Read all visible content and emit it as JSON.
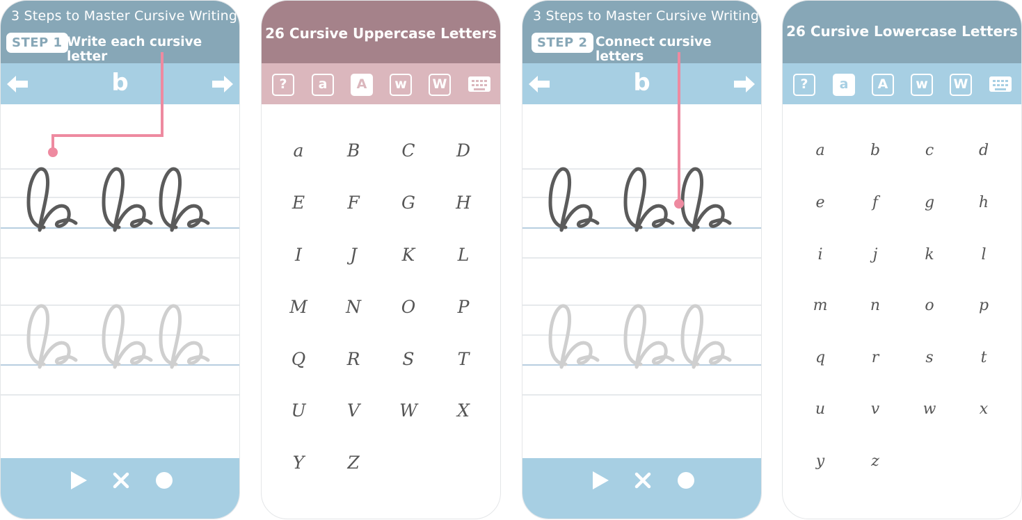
{
  "screens": {
    "step1": {
      "title": "3 Steps to Master Cursive Writing",
      "badge": "STEP 1",
      "caption": "Write each cursive letter",
      "letter": "b"
    },
    "uppercase": {
      "title": "26 Cursive Uppercase Letters",
      "tools": [
        "?",
        "a",
        "A",
        "w",
        "W"
      ],
      "active_tool": "A",
      "letters": [
        "a",
        "B",
        "C",
        "D",
        "E",
        "F",
        "G",
        "H",
        "I",
        "J",
        "K",
        "L",
        "M",
        "N",
        "O",
        "P",
        "Q",
        "R",
        "S",
        "T",
        "U",
        "V",
        "W",
        "X",
        "Y",
        "Z"
      ]
    },
    "step2": {
      "title": "3 Steps to Master Cursive Writing",
      "badge": "STEP 2",
      "caption": "Connect cursive letters",
      "letter": "b"
    },
    "lowercase": {
      "title": "26 Cursive Lowercase Letters",
      "tools": [
        "?",
        "a",
        "A",
        "w",
        "W"
      ],
      "active_tool": "a",
      "letters": [
        "a",
        "b",
        "c",
        "d",
        "e",
        "f",
        "g",
        "h",
        "i",
        "j",
        "k",
        "l",
        "m",
        "n",
        "o",
        "p",
        "q",
        "r",
        "s",
        "t",
        "u",
        "v",
        "w",
        "x",
        "y",
        "z"
      ]
    }
  },
  "controls": [
    "play-icon",
    "clear-icon",
    "record-icon"
  ],
  "colors": {
    "header_blue": "#87a7b7",
    "bar_blue": "#a7cfe3",
    "header_rose": "#a5828a",
    "bar_rose": "#dbb7bd",
    "pointer_pink": "#ee8aa0",
    "stroke_dark": "#5b5b5b",
    "stroke_light": "#cfcfcf"
  }
}
